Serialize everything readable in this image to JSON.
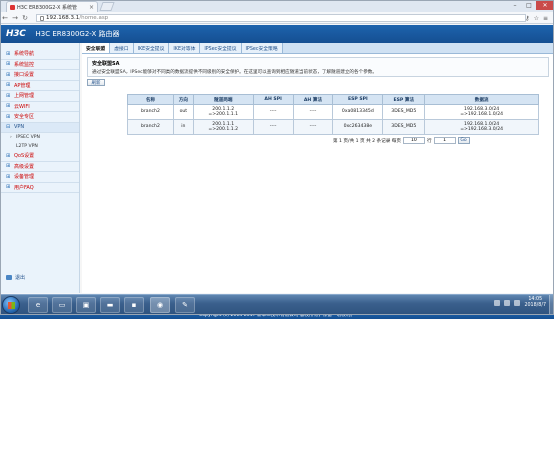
{
  "browser": {
    "tab_title": "H3C ER8300G2-X 系统管",
    "url_host": "192.168.3.1",
    "url_path": "/home.asp"
  },
  "header": {
    "logo": "H3C",
    "product": "H3C ER8300G2-X 路由器"
  },
  "sidebar": {
    "items": [
      {
        "label": "系统导航"
      },
      {
        "label": "系统监控"
      },
      {
        "label": "接口设置"
      },
      {
        "label": "AP管理"
      },
      {
        "label": "上网管理"
      },
      {
        "label": "云WIFI"
      },
      {
        "label": "安全专区"
      },
      {
        "label": "VPN"
      }
    ],
    "vpn_sub": [
      {
        "label": "IPSEC VPN"
      },
      {
        "label": "L2TP VPN"
      }
    ],
    "items_after": [
      {
        "label": "QoS设置"
      },
      {
        "label": "高级设置"
      },
      {
        "label": "设备管理"
      },
      {
        "label": "用户FAQ"
      }
    ],
    "logout": "退出"
  },
  "subtabs": [
    "安全联盟",
    "虚接口",
    "IKE安全提议",
    "IKE对等体",
    "IPSec安全提议",
    "IPSec安全策略"
  ],
  "panel": {
    "title": "安全联盟SA",
    "description": "通过安全联盟SA，IPSec能够对不同类的数据流提供不同级别的安全保护。在这里可以查询到相应隧道当前状态，了解隧道建立的各个参数。"
  },
  "refresh_label": "刷新",
  "table": {
    "headers": [
      "名称",
      "方向",
      "隧道两端",
      "AH SPI",
      "AH 算法",
      "ESP SPI",
      "ESP 算法",
      "数据流"
    ],
    "rows": [
      {
        "name": "branch2",
        "dir": "out",
        "ends1": "200.1.1.2",
        "ends2": "=>200.1.1.1",
        "ah_spi": "----",
        "ah_alg": "----",
        "esp_spi": "0xa0813345d",
        "esp_alg": "3DES_MD5",
        "flow1": "192.168.3.0/24",
        "flow2": "=>192.168.1.0/24"
      },
      {
        "name": "branch2",
        "dir": "in",
        "ends1": "200.1.1.1",
        "ends2": "=>200.1.1.2",
        "ah_spi": "----",
        "ah_alg": "----",
        "esp_spi": "0xc263438e",
        "esp_alg": "3DES_MD5",
        "flow1": "192.168.1.0/24",
        "flow2": "=>192.168.3.0/24"
      }
    ]
  },
  "pager": {
    "summary": "第 1 页/共 1 页 共 2 条记录 每页",
    "per_page": "10",
    "rows_unit": "行",
    "page": "1",
    "go": "Go"
  },
  "footer": "Copyright (c) 2014-2017 新华三技术有限公司 版权所有，保留一切权利。",
  "taskbar": {
    "time": "14:05",
    "date": "2018/8/7"
  }
}
